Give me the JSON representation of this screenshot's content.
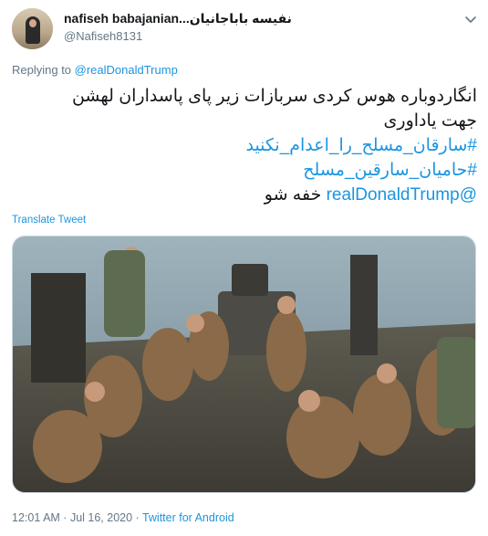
{
  "author": {
    "display_name": "nafiseh babajanian...نفیسه باباجانیان",
    "handle": "@Nafiseh8131"
  },
  "reply": {
    "prefix": "Replying to ",
    "mention": "@realDonaldTrump"
  },
  "tweet": {
    "line1": "انگاردوباره هوس کردی سربازات زیر پای پاسداران لهشن",
    "line2": "جهت یاداوری",
    "hashtag1": "#سارقان_مسلح_را_اعدام_نکنید",
    "hashtag2": "#حامیان_سارقین_مسلح",
    "mention": "@realDonaldTrump",
    "closing": " خفه شو"
  },
  "translate_label": "Translate Tweet",
  "media": {
    "description_icon": "photo"
  },
  "footer": {
    "time": "12:01 AM",
    "separator1": " · ",
    "date": "Jul 16, 2020",
    "separator2": " · ",
    "source": "Twitter for Android"
  },
  "colors": {
    "link": "#1b95e0",
    "secondary": "#657786",
    "text": "#14171a"
  }
}
